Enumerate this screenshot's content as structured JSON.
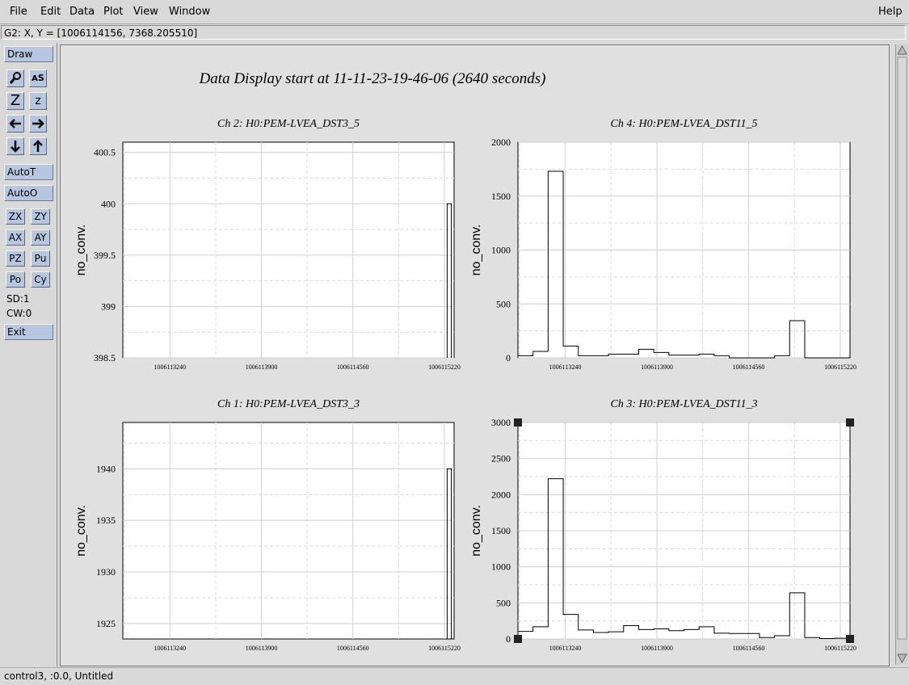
{
  "menubar": {
    "items": [
      {
        "label": "File"
      },
      {
        "label": "Edit"
      },
      {
        "label": "Data"
      },
      {
        "label": "Plot"
      },
      {
        "label": "View"
      },
      {
        "label": "Window"
      }
    ],
    "help": "Help"
  },
  "coordline": "G2: X, Y = [1006114156, 7368.205510]",
  "toolbar": {
    "draw": "Draw",
    "autoT": "AutoT",
    "autoO": "AutoO",
    "icons": [
      "magnify-icon",
      "label-icon",
      "zoom-z-icon",
      "zoom-z-small-icon",
      "left-arrow-icon",
      "right-arrow-icon",
      "down-arrow-icon",
      "up-arrow-icon"
    ],
    "small": [
      "ZX",
      "ZY",
      "AX",
      "AY",
      "PZ",
      "Pu",
      "Po",
      "Cy"
    ],
    "sd": "SD:1",
    "cw": "CW:0",
    "exit": "Exit"
  },
  "title": "Data Display start at 11-11-23-19-46-06 (2640 seconds)",
  "statusbar": "control3, :0.0, Untitled",
  "chart_data": [
    {
      "type": "line",
      "title": "Ch 2: H0:PEM-LVEA_DST3_5",
      "ylabel": "no_conv.",
      "xticks": [
        "1006113240",
        "1006113900",
        "1006114560",
        "1006115220"
      ],
      "yticks": [
        "400.5",
        "400",
        "399.5",
        "399",
        "398.5"
      ],
      "ylim": [
        398.5,
        400.6
      ],
      "series": [
        {
          "x": [
            1006115240,
            1006115270
          ],
          "values": [
            400,
            400
          ]
        }
      ]
    },
    {
      "type": "line",
      "title": "Ch 4: H0:PEM-LVEA_DST11_5",
      "ylabel": "no_conv.",
      "xticks": [
        "1006113240",
        "1006113900",
        "1006114560",
        "1006115220"
      ],
      "yticks": [
        "2000",
        "1500",
        "1000",
        "500",
        "0"
      ],
      "ylim": [
        0,
        2000
      ],
      "series": [
        {
          "values": [
            20,
            60,
            1730,
            110,
            20,
            20,
            35,
            35,
            80,
            50,
            25,
            25,
            35,
            20,
            0,
            0,
            0,
            20,
            345,
            0,
            0,
            0
          ]
        }
      ]
    },
    {
      "type": "line",
      "title": "Ch 1: H0:PEM-LVEA_DST3_3",
      "ylabel": "no_conv.",
      "xticks": [
        "1006113240",
        "1006113900",
        "1006114560",
        "1006115220"
      ],
      "yticks": [
        "1940",
        "1935",
        "1930",
        "1925"
      ],
      "ylim": [
        1923.5,
        1944.5
      ],
      "series": [
        {
          "x": [
            1006115240,
            1006115270
          ],
          "values": [
            1940,
            1940
          ]
        }
      ]
    },
    {
      "type": "line",
      "title": "Ch 3: H0:PEM-LVEA_DST11_3",
      "ylabel": "no_conv.",
      "xticks": [
        "1006113240",
        "1006113900",
        "1006114560",
        "1006115220"
      ],
      "yticks": [
        "3000",
        "2500",
        "2000",
        "1500",
        "1000",
        "500",
        "0"
      ],
      "ylim": [
        0,
        3000
      ],
      "series": [
        {
          "values": [
            105,
            170,
            2220,
            340,
            125,
            90,
            100,
            185,
            130,
            140,
            115,
            130,
            170,
            80,
            75,
            75,
            20,
            45,
            640,
            20,
            5,
            10
          ]
        }
      ]
    }
  ]
}
